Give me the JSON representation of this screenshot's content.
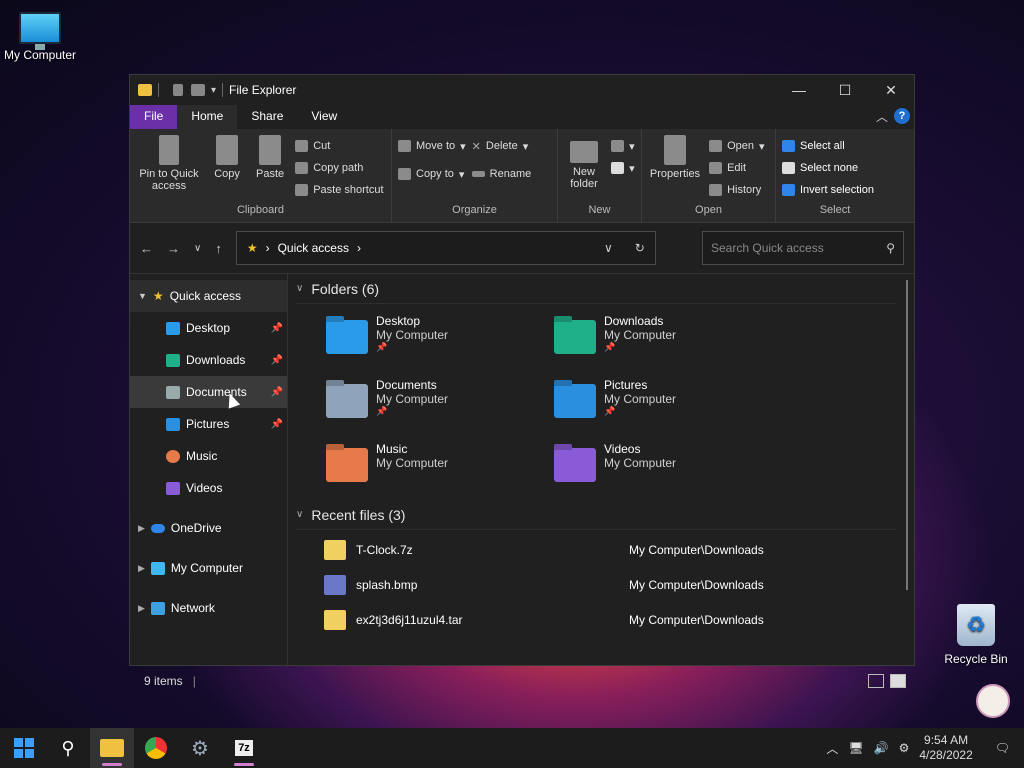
{
  "desktop": {
    "my_computer": "My Computer",
    "recycle_bin": "Recycle Bin"
  },
  "window": {
    "title": "File Explorer"
  },
  "tabs": [
    "File",
    "Home",
    "Share",
    "View"
  ],
  "ribbon": {
    "clipboard": {
      "name": "Clipboard",
      "pin": "Pin to Quick access",
      "copy": "Copy",
      "paste": "Paste",
      "cut": "Cut",
      "copy_path": "Copy path",
      "paste_shortcut": "Paste shortcut"
    },
    "organize": {
      "name": "Organize",
      "move_to": "Move to",
      "copy_to": "Copy to",
      "delete": "Delete",
      "rename": "Rename"
    },
    "new": {
      "name": "New",
      "new_folder": "New folder"
    },
    "open": {
      "name": "Open",
      "properties": "Properties",
      "open": "Open",
      "edit": "Edit",
      "history": "History"
    },
    "select": {
      "name": "Select",
      "select_all": "Select all",
      "select_none": "Select none",
      "invert": "Invert selection"
    }
  },
  "address": {
    "path": "Quick access",
    "search_placeholder": "Search Quick access"
  },
  "sidebar": [
    {
      "label": "Quick access",
      "expanded": true
    },
    {
      "label": "Desktop",
      "pinned": true
    },
    {
      "label": "Downloads",
      "pinned": true
    },
    {
      "label": "Documents",
      "pinned": true
    },
    {
      "label": "Pictures",
      "pinned": true
    },
    {
      "label": "Music"
    },
    {
      "label": "Videos"
    },
    {
      "label": "OneDrive"
    },
    {
      "label": "My Computer"
    },
    {
      "label": "Network"
    }
  ],
  "folders_header": "Folders (6)",
  "folders": [
    {
      "name": "Desktop",
      "sub": "My Computer",
      "color": "#2a9be8"
    },
    {
      "name": "Downloads",
      "sub": "My Computer",
      "color": "#1fb08a"
    },
    {
      "name": "Documents",
      "sub": "My Computer",
      "color": "#8fa4bb"
    },
    {
      "name": "Pictures",
      "sub": "My Computer",
      "color": "#2b8fe0"
    },
    {
      "name": "Music",
      "sub": "My Computer",
      "color": "#e67a4a"
    },
    {
      "name": "Videos",
      "sub": "My Computer",
      "color": "#8a5bd6"
    }
  ],
  "recent_header": "Recent files (3)",
  "recent": [
    {
      "name": "T-Clock.7z",
      "path": "My Computer\\Downloads"
    },
    {
      "name": "splash.bmp",
      "path": "My Computer\\Downloads"
    },
    {
      "name": "ex2tj3d6j11uzul4.tar",
      "path": "My Computer\\Downloads"
    }
  ],
  "status": "9 items",
  "clock": {
    "time": "9:54 AM",
    "date": "4/28/2022"
  }
}
